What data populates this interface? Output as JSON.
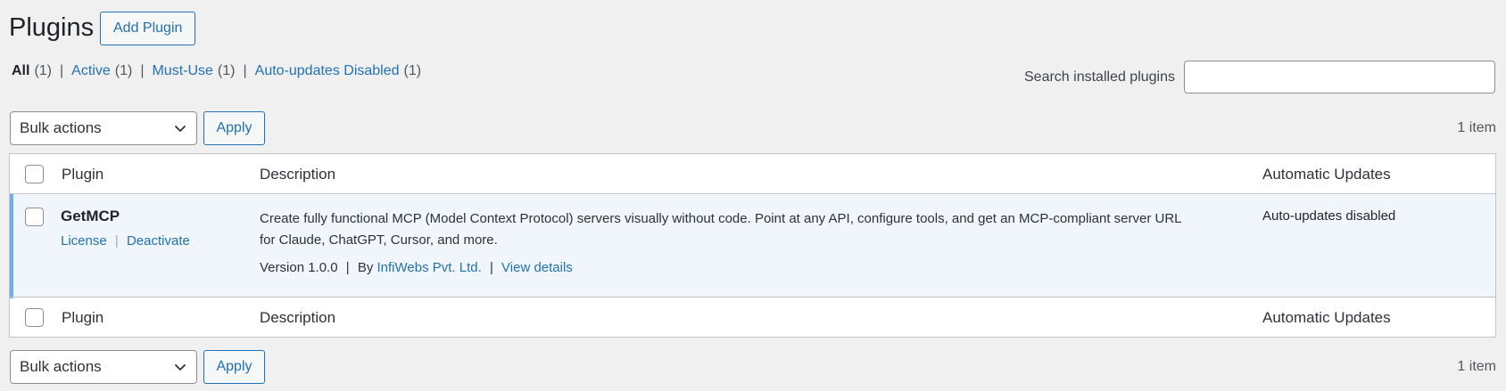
{
  "header": {
    "title": "Plugins",
    "add_button": "Add Plugin"
  },
  "filters": [
    {
      "label": "All",
      "count": "(1)",
      "current": true
    },
    {
      "label": "Active",
      "count": "(1)"
    },
    {
      "label": "Must-Use",
      "count": "(1)"
    },
    {
      "label": "Auto-updates Disabled",
      "count": "(1)"
    }
  ],
  "filter_separator": "|",
  "search": {
    "label": "Search installed plugins",
    "value": "",
    "placeholder": ""
  },
  "bulk_top": {
    "selected": "Bulk actions",
    "apply": "Apply",
    "count": "1 item"
  },
  "bulk_bottom": {
    "selected": "Bulk actions",
    "apply": "Apply",
    "count": "1 item"
  },
  "table": {
    "columns": {
      "plugin": "Plugin",
      "description": "Description",
      "auto_updates": "Automatic Updates"
    },
    "rows": [
      {
        "name": "GetMCP",
        "actions": [
          "License",
          "Deactivate"
        ],
        "description": "Create fully functional MCP (Model Context Protocol) servers visually without code. Point at any API, configure tools, and get an MCP-compliant server URL for Claude, ChatGPT, Cursor, and more.",
        "version": "Version 1.0.0",
        "by_label": "By",
        "author": "InfiWebs Pvt. Ltd.",
        "details_link": "View details",
        "auto_updates": "Auto-updates disabled"
      }
    ]
  },
  "colors": {
    "accent": "#2271b1",
    "active_row_bg": "#f0f6fc",
    "active_row_border": "#72aee6",
    "page_bg": "#f0f0f1"
  },
  "icons": {
    "select_arrow": "chevron-down-icon"
  }
}
